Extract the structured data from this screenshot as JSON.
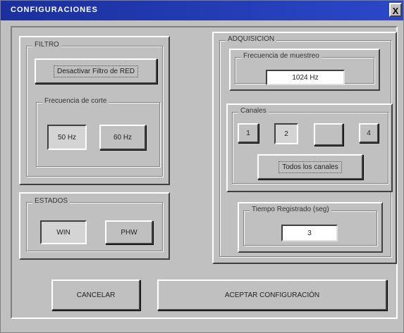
{
  "window": {
    "title": "CONFIGURACIONES",
    "close_glyph": "X"
  },
  "filtro": {
    "label": "FILTRO",
    "button_label": "Desactivar Filtro de RED",
    "cutoff_group": {
      "label": "Frecuencia de corte",
      "options": [
        "50 Hz",
        "60 Hz"
      ],
      "selected": "50 Hz"
    }
  },
  "estados": {
    "label": "ESTADOS",
    "options": [
      "WIN",
      "PHW"
    ],
    "selected": "WIN"
  },
  "adquisicion": {
    "label": "ADQUISICION",
    "sampling": {
      "label": "Frecuencia de muestreo",
      "value": "1024 Hz"
    },
    "canales": {
      "label": "Canales",
      "channels": [
        "1",
        "2",
        "",
        "4"
      ],
      "selected": "2",
      "all_button": "Todos los canales"
    },
    "time": {
      "label": "Tiempo Registrado (seg)",
      "value": "3"
    }
  },
  "footer": {
    "cancel_label": "CANCELAR",
    "accept_label": "ACEPTAR CONFIGURACIÓN"
  },
  "colors": {
    "titlebar": "#2a48c8",
    "face": "#c0c0c0"
  }
}
